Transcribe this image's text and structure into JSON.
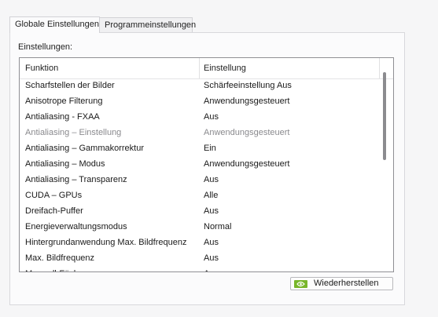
{
  "tabs": [
    {
      "label": "Globale Einstellungen",
      "active": true
    },
    {
      "label": "Programmeinstellungen",
      "active": false
    }
  ],
  "settings_label": "Einstellungen:",
  "table": {
    "columns": [
      "Funktion",
      "Einstellung"
    ],
    "rows": [
      {
        "feature": "Scharfstellen der Bilder",
        "setting": "Schärfeeinstellung Aus",
        "disabled": false
      },
      {
        "feature": "Anisotrope Filterung",
        "setting": "Anwendungsgesteuert",
        "disabled": false
      },
      {
        "feature": "Antialiasing - FXAA",
        "setting": "Aus",
        "disabled": false
      },
      {
        "feature": "Antialiasing – Einstellung",
        "setting": "Anwendungsgesteuert",
        "disabled": true
      },
      {
        "feature": "Antialiasing – Gammakorrektur",
        "setting": "Ein",
        "disabled": false
      },
      {
        "feature": "Antialiasing – Modus",
        "setting": "Anwendungsgesteuert",
        "disabled": false
      },
      {
        "feature": "Antialiasing – Transparenz",
        "setting": "Aus",
        "disabled": false
      },
      {
        "feature": "CUDA – GPUs",
        "setting": "Alle",
        "disabled": false
      },
      {
        "feature": "Dreifach-Puffer",
        "setting": "Aus",
        "disabled": false
      },
      {
        "feature": "Energieverwaltungsmodus",
        "setting": "Normal",
        "disabled": false
      },
      {
        "feature": "Hintergrundanwendung Max. Bildfrequenz",
        "setting": "Aus",
        "disabled": false
      },
      {
        "feature": "Max. Bildfrequenz",
        "setting": "Aus",
        "disabled": false
      },
      {
        "feature": "Maxwell-Fächer...",
        "setting": "Aus",
        "disabled": false
      }
    ]
  },
  "restore_button": {
    "label": "Wiederherstellen",
    "icon": "nvidia-logo-icon",
    "icon_color": "#78b62a"
  }
}
